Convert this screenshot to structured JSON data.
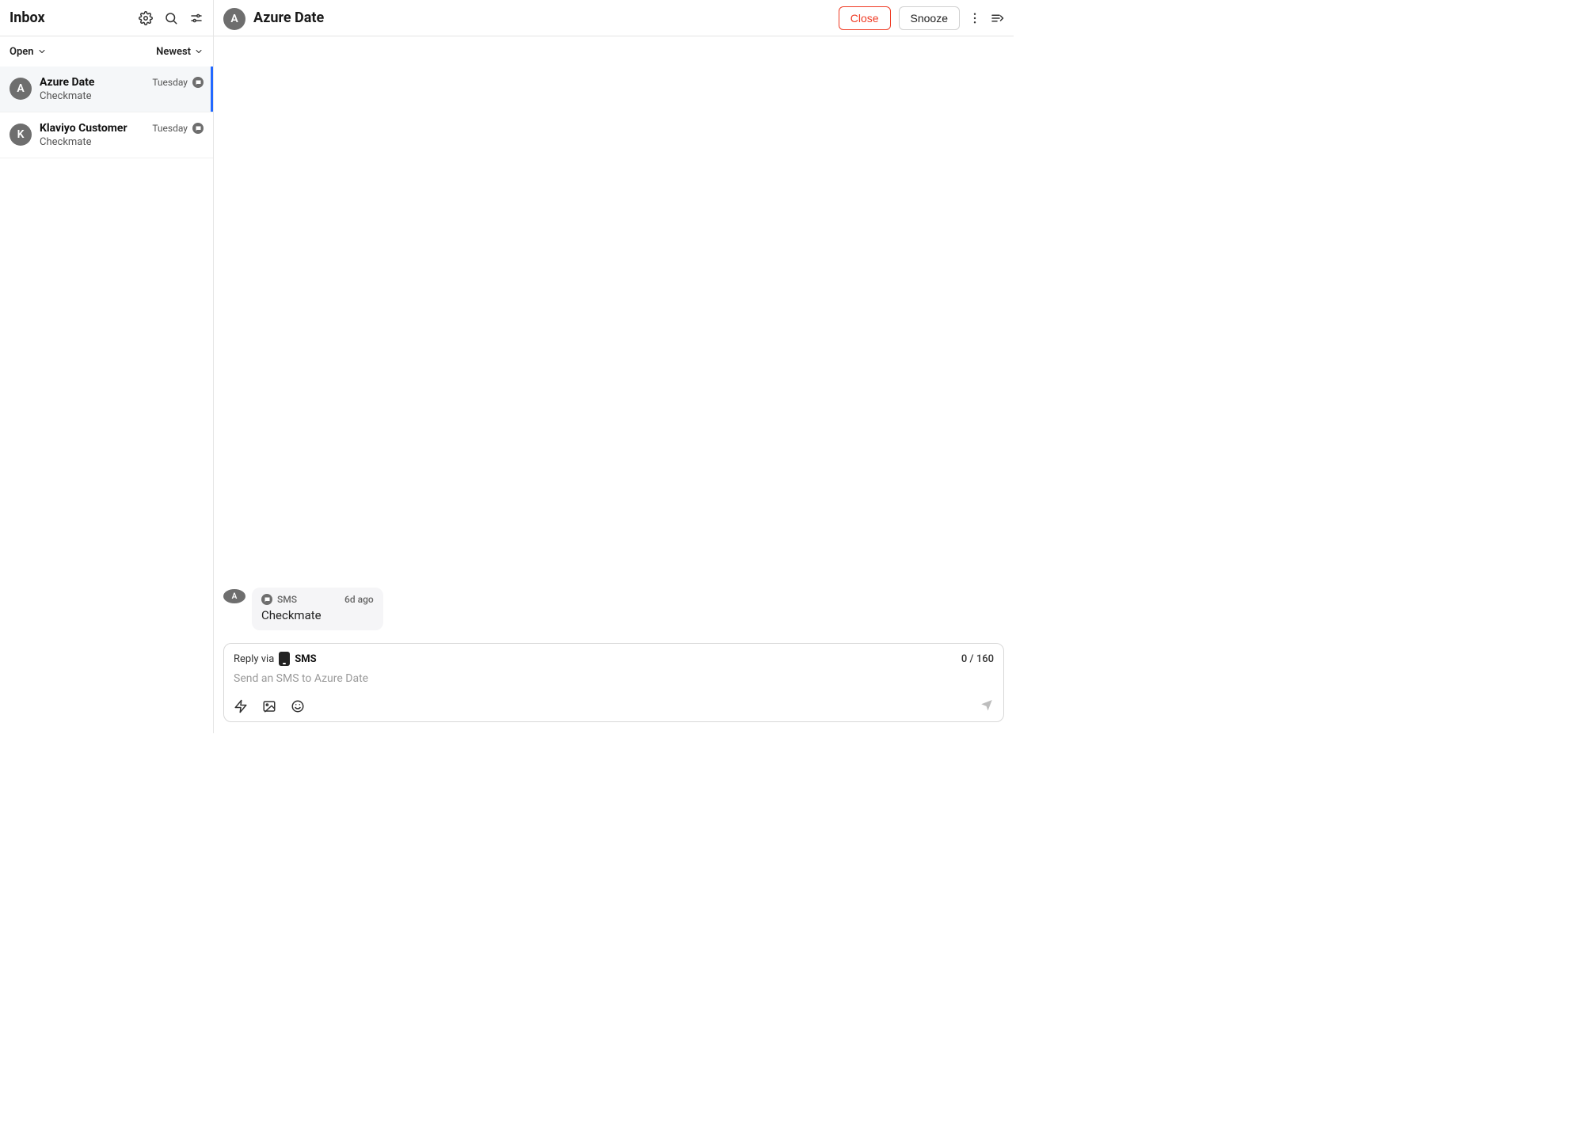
{
  "sidebar": {
    "title": "Inbox",
    "filter_status": "Open",
    "filter_sort": "Newest"
  },
  "threads": [
    {
      "initial": "A",
      "name": "Azure Date",
      "preview": "Checkmate",
      "time": "Tuesday",
      "selected": true
    },
    {
      "initial": "K",
      "name": "Klaviyo Customer",
      "preview": "Checkmate",
      "time": "Tuesday",
      "selected": false
    }
  ],
  "conversation": {
    "avatar_initial": "A",
    "title": "Azure Date",
    "close_label": "Close",
    "snooze_label": "Snooze",
    "messages": [
      {
        "avatar_initial": "A",
        "channel": "SMS",
        "time": "6d ago",
        "body": "Checkmate"
      }
    ],
    "composer": {
      "reply_via_label": "Reply via",
      "channel": "SMS",
      "placeholder": "Send an SMS to Azure Date",
      "counter": "0 / 160"
    }
  }
}
